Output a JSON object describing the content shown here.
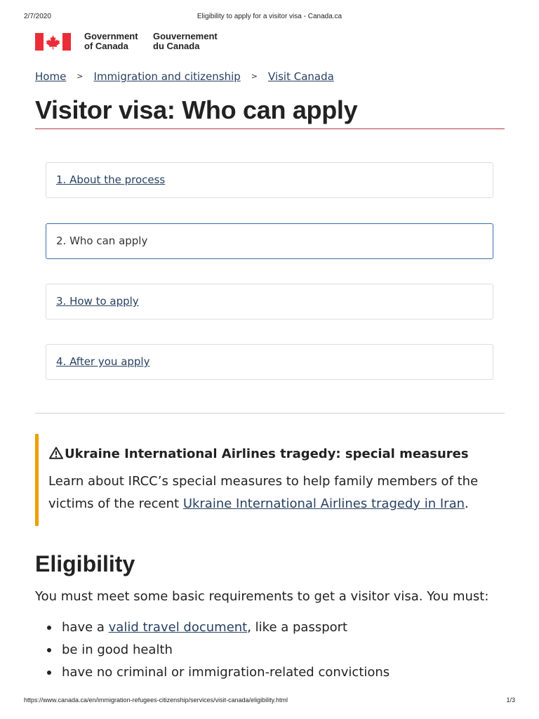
{
  "print_header": {
    "date": "2/7/2020",
    "title": "Eligibility to apply for a visitor visa - Canada.ca"
  },
  "print_footer": {
    "url": "https://www.canada.ca/en/immigration-refugees-citizenship/services/visit-canada/eligibility.html",
    "page": "1/3"
  },
  "brand": {
    "en_line1": "Government",
    "en_line2": "of Canada",
    "fr_line1": "Gouvernement",
    "fr_line2": "du Canada",
    "flag_color": "#eb2d37"
  },
  "breadcrumb": {
    "items": [
      "Home",
      "Immigration and citizenship",
      "Visit Canada"
    ],
    "separator": ">"
  },
  "page_title": "Visitor visa: Who can apply",
  "steps": [
    {
      "label": "1. About the process",
      "active": false
    },
    {
      "label": "2. Who can apply",
      "active": true
    },
    {
      "label": "3. How to apply",
      "active": false
    },
    {
      "label": "4. After you apply",
      "active": false
    }
  ],
  "alert": {
    "icon": "warning-icon",
    "heading": "Ukraine International Airlines tragedy: special measures",
    "body_before": "Learn about IRCC’s special measures to help family members of the victims of the recent ",
    "body_link": "Ukraine International Airlines tragedy in Iran",
    "body_after": ".",
    "accent_color": "#ee9e00"
  },
  "eligibility": {
    "heading": "Eligibility",
    "intro": "You must meet some basic requirements to get a visitor visa. You must:",
    "items": [
      {
        "before": "have a ",
        "link": "valid travel document",
        "after": ", like a passport"
      },
      {
        "before": "be in good health",
        "link": "",
        "after": ""
      },
      {
        "before": "have no criminal or immigration-related convictions",
        "link": "",
        "after": ""
      }
    ]
  },
  "colors": {
    "link": "#284162",
    "title_rule": "#af3c43",
    "active_border": "#3a6fa8"
  }
}
